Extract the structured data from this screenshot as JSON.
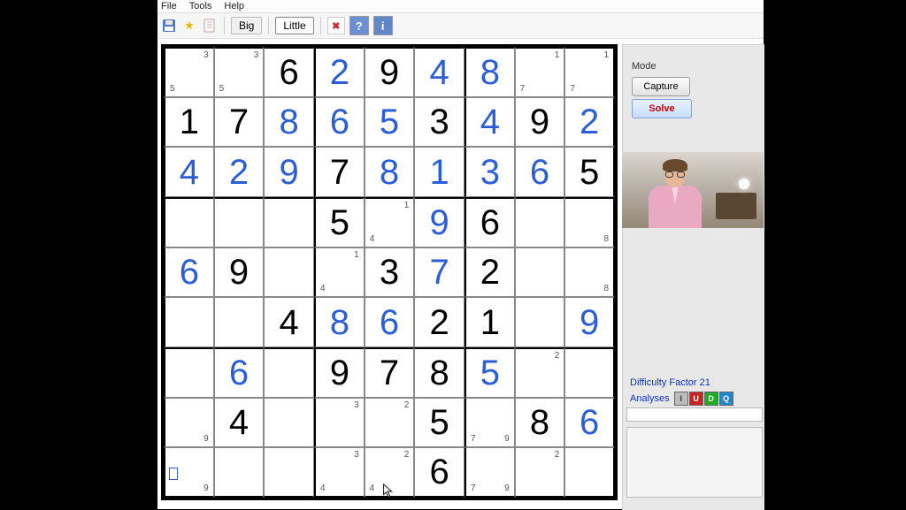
{
  "menu": {
    "file": "File",
    "tools": "Tools",
    "help": "Help"
  },
  "toolbar": {
    "big": "Big",
    "little": "Little",
    "help": "?",
    "info": "i",
    "del": "✖"
  },
  "mode": {
    "title": "Mode",
    "capture": "Capture",
    "solve": "Solve"
  },
  "difficulty": "Difficulty Factor 21",
  "analyses": {
    "label": "Analyses",
    "i": "I",
    "u": "U",
    "d": "D",
    "q": "Q"
  },
  "grid": [
    [
      {
        "pm": {
          "tr": "3",
          "bl": "5"
        }
      },
      {
        "pm": {
          "tr": "3",
          "bl": "5"
        }
      },
      {
        "v": "6",
        "t": "g"
      },
      {
        "v": "2",
        "t": "s"
      },
      {
        "v": "9",
        "t": "g"
      },
      {
        "v": "4",
        "t": "s"
      },
      {
        "v": "8",
        "t": "s"
      },
      {
        "pm": {
          "tr": "1",
          "bl": "7"
        }
      },
      {
        "pm": {
          "tr": "1",
          "bl": "7"
        }
      }
    ],
    [
      {
        "v": "1",
        "t": "g"
      },
      {
        "v": "7",
        "t": "g"
      },
      {
        "v": "8",
        "t": "s"
      },
      {
        "v": "6",
        "t": "s"
      },
      {
        "v": "5",
        "t": "s"
      },
      {
        "v": "3",
        "t": "g"
      },
      {
        "v": "4",
        "t": "s"
      },
      {
        "v": "9",
        "t": "g"
      },
      {
        "v": "2",
        "t": "s"
      }
    ],
    [
      {
        "v": "4",
        "t": "s"
      },
      {
        "v": "2",
        "t": "s"
      },
      {
        "v": "9",
        "t": "s"
      },
      {
        "v": "7",
        "t": "g"
      },
      {
        "v": "8",
        "t": "s"
      },
      {
        "v": "1",
        "t": "s"
      },
      {
        "v": "3",
        "t": "s"
      },
      {
        "v": "6",
        "t": "s"
      },
      {
        "v": "5",
        "t": "g"
      }
    ],
    [
      {},
      {},
      {},
      {
        "v": "5",
        "t": "g"
      },
      {
        "pm": {
          "tr": "1",
          "bl": "4"
        }
      },
      {
        "v": "9",
        "t": "s"
      },
      {
        "v": "6",
        "t": "g"
      },
      {},
      {
        "pm": {
          "br": "8"
        }
      }
    ],
    [
      {
        "v": "6",
        "t": "s"
      },
      {
        "v": "9",
        "t": "g"
      },
      {},
      {
        "pm": {
          "tr": "1",
          "bl": "4"
        }
      },
      {
        "v": "3",
        "t": "g"
      },
      {
        "v": "7",
        "t": "s"
      },
      {
        "v": "2",
        "t": "g"
      },
      {},
      {
        "pm": {
          "br": "8"
        }
      }
    ],
    [
      {},
      {},
      {
        "v": "4",
        "t": "g"
      },
      {
        "v": "8",
        "t": "s"
      },
      {
        "v": "6",
        "t": "s"
      },
      {
        "v": "2",
        "t": "g"
      },
      {
        "v": "1",
        "t": "g"
      },
      {},
      {
        "v": "9",
        "t": "s"
      }
    ],
    [
      {},
      {
        "v": "6",
        "t": "s"
      },
      {},
      {
        "v": "9",
        "t": "g"
      },
      {
        "v": "7",
        "t": "g"
      },
      {
        "v": "8",
        "t": "g"
      },
      {
        "v": "5",
        "t": "s"
      },
      {
        "pm": {
          "tr": "2"
        }
      },
      {}
    ],
    [
      {
        "pm": {
          "br": "9"
        }
      },
      {
        "v": "4",
        "t": "g"
      },
      {},
      {
        "pm": {
          "tr": "3"
        }
      },
      {
        "pm": {
          "tr": "2"
        }
      },
      {
        "v": "5",
        "t": "g"
      },
      {
        "pm": {
          "bl": "7",
          "br": "9"
        }
      },
      {
        "v": "8",
        "t": "g"
      },
      {
        "v": "6",
        "t": "s"
      }
    ],
    [
      {
        "pm": {
          "br": "9"
        },
        "mark": true
      },
      {},
      {},
      {
        "pm": {
          "tr": "3",
          "bl": "4"
        }
      },
      {
        "pm": {
          "tr": "2",
          "bl": "4"
        }
      },
      {
        "v": "6",
        "t": "g"
      },
      {
        "pm": {
          "bl": "7",
          "br": "9"
        }
      },
      {
        "pm": {
          "tr": "2"
        }
      },
      {}
    ]
  ]
}
